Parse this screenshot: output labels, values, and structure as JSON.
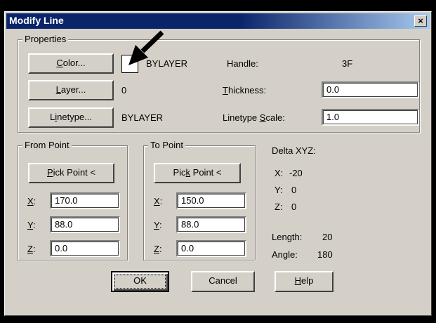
{
  "title": "Modify Line",
  "close_glyph": "×",
  "properties": {
    "legend": "Properties",
    "color_button_pre": "",
    "color_button_ul": "C",
    "color_button_post": "olor...",
    "color_value": "BYLAYER",
    "layer_button_pre": "",
    "layer_button_ul": "L",
    "layer_button_post": "ayer...",
    "layer_value": "0",
    "linetype_button_pre": "L",
    "linetype_button_ul": "i",
    "linetype_button_post": "netype...",
    "linetype_value": "BYLAYER",
    "handle_label": "Handle:",
    "handle_value": "3F",
    "thickness_label_ul": "T",
    "thickness_label_post": "hickness:",
    "thickness_value": "0.0",
    "ltscale_label_pre": "Linetype ",
    "ltscale_label_ul": "S",
    "ltscale_label_post": "cale:",
    "ltscale_value": "1.0"
  },
  "from_point": {
    "legend": "From Point",
    "pick_pre": "",
    "pick_ul": "P",
    "pick_post": "ick Point <",
    "x_label": "X",
    "x_colon": ":",
    "x_value": "170.0",
    "y_label": "Y",
    "y_colon": ":",
    "y_value": "88.0",
    "z_label": "Z",
    "z_colon": ":",
    "z_value": "0.0"
  },
  "to_point": {
    "legend": "To Point",
    "pick_pre": "Pic",
    "pick_ul": "k",
    "pick_post": " Point <",
    "x_label": "X",
    "x_colon": ":",
    "x_value": "150.0",
    "y_label": "Y",
    "y_colon": ":",
    "y_value": "88.0",
    "z_label": "Z",
    "z_colon": ":",
    "z_value": "0.0"
  },
  "delta": {
    "heading": "Delta XYZ:",
    "x_label": "X:",
    "x_value": "-20",
    "y_label": "Y:",
    "y_value": "0",
    "z_label": "Z:",
    "z_value": "0",
    "length_label": "Length:",
    "length_value": "20",
    "angle_label": "Angle:",
    "angle_value": "180"
  },
  "buttons": {
    "ok": "OK",
    "cancel": "Cancel",
    "help_ul": "H",
    "help_post": "elp"
  },
  "annotation": {
    "arrow_color": "#000000"
  }
}
